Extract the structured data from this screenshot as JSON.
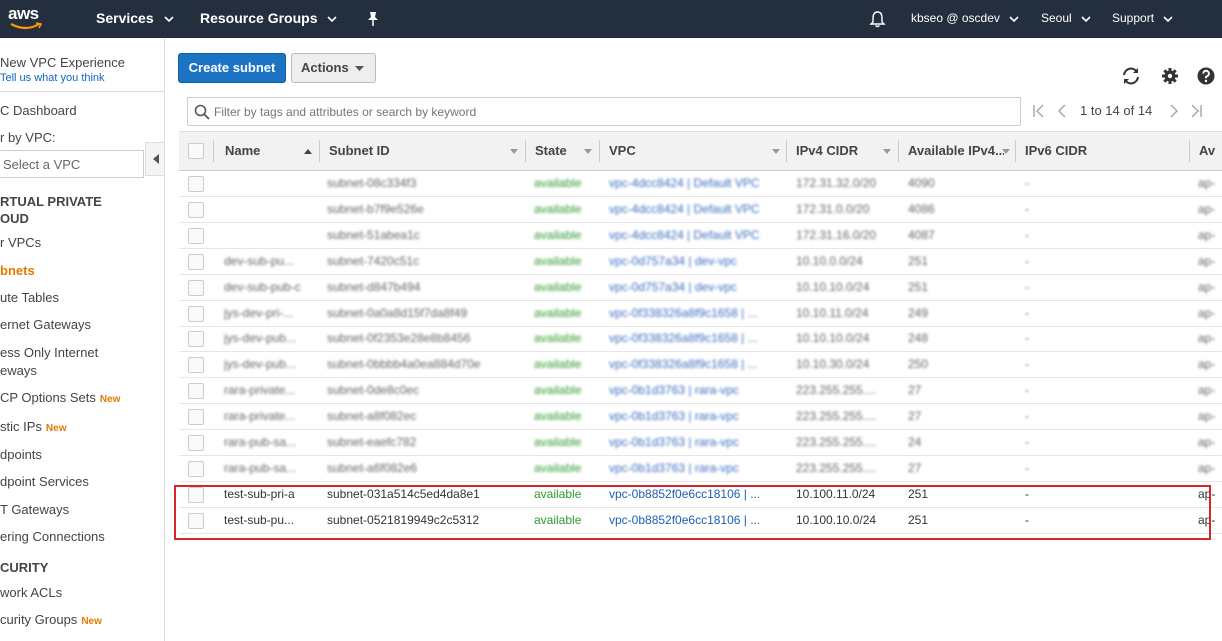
{
  "nav": {
    "logo": "aws",
    "services": "Services",
    "resource_groups": "Resource Groups",
    "user": "kbseo @ oscdev",
    "region": "Seoul",
    "support": "Support"
  },
  "sidebar": {
    "new_experience": "New VPC Experience",
    "tell_us": "Tell us what you think",
    "dashboard": "C Dashboard",
    "filter_label": "r by VPC:",
    "vpc_select": "Select a VPC",
    "section_vpc_1": "RTUAL PRIVATE",
    "section_vpc_2": "OUD",
    "your_vpcs": "r VPCs",
    "subnets": "bnets",
    "route_tables": "ute Tables",
    "internet_gateways": "ernet Gateways",
    "egress_1": "ess Only Internet",
    "egress_2": "eways",
    "dhcp": "CP Options Sets",
    "elastic_ips": "stic IPs",
    "endpoints": "dpoints",
    "endpoint_services": "dpoint Services",
    "nat": "T Gateways",
    "peering": "ering Connections",
    "section_security": "CURITY",
    "network_acls": "work ACLs",
    "security_groups": "curity Groups",
    "new_badge": "New"
  },
  "toolbar": {
    "create_subnet": "Create subnet",
    "actions": "Actions"
  },
  "filter": {
    "placeholder": "Filter by tags and attributes or search by keyword"
  },
  "pager": {
    "range": "1 to 14 of 14"
  },
  "table": {
    "headers": {
      "name": "Name",
      "subnet_id": "Subnet ID",
      "state": "State",
      "vpc": "VPC",
      "ipv4": "IPv4 CIDR",
      "avail": "Available IPv4...",
      "ipv6": "IPv6 CIDR",
      "az": "Av"
    },
    "rows": [
      {
        "name": "",
        "subnet": "subnet-08c334f3",
        "state": "available",
        "vpc": "vpc-4dcc8424 | Default VPC",
        "ipv4": "172.31.32.0/20",
        "avail": "4090",
        "ipv6": "-",
        "az": "ap-"
      },
      {
        "name": "",
        "subnet": "subnet-b7f9e526e",
        "state": "available",
        "vpc": "vpc-4dcc8424 | Default VPC",
        "ipv4": "172.31.0.0/20",
        "avail": "4086",
        "ipv6": "-",
        "az": "ap-"
      },
      {
        "name": "",
        "subnet": "subnet-51abea1c",
        "state": "available",
        "vpc": "vpc-4dcc8424 | Default VPC",
        "ipv4": "172.31.16.0/20",
        "avail": "4087",
        "ipv6": "-",
        "az": "ap-"
      },
      {
        "name": "dev-sub-pu...",
        "subnet": "subnet-7420c51c",
        "state": "available",
        "vpc": "vpc-0d757a34 | dev-vpc",
        "ipv4": "10.10.0.0/24",
        "avail": "251",
        "ipv6": "-",
        "az": "ap-"
      },
      {
        "name": "dev-sub-pub-c",
        "subnet": "subnet-d847b494",
        "state": "available",
        "vpc": "vpc-0d757a34 | dev-vpc",
        "ipv4": "10.10.10.0/24",
        "avail": "251",
        "ipv6": "-",
        "az": "ap-"
      },
      {
        "name": "jys-dev-pri-...",
        "subnet": "subnet-0a0a8d15f7da8f49",
        "state": "available",
        "vpc": "vpc-0f338326a8f9c1658 | ...",
        "ipv4": "10.10.11.0/24",
        "avail": "249",
        "ipv6": "-",
        "az": "ap-"
      },
      {
        "name": "jys-dev-pub...",
        "subnet": "subnet-0f2353e28e8b8456",
        "state": "available",
        "vpc": "vpc-0f338326a8f9c1658 | ...",
        "ipv4": "10.10.10.0/24",
        "avail": "248",
        "ipv6": "-",
        "az": "ap-"
      },
      {
        "name": "jys-dev-pub...",
        "subnet": "subnet-0bbbb4a0ea884d70e",
        "state": "available",
        "vpc": "vpc-0f338326a8f9c1658 | ...",
        "ipv4": "10.10.30.0/24",
        "avail": "250",
        "ipv6": "-",
        "az": "ap-"
      },
      {
        "name": "rara-private...",
        "subnet": "subnet-0de8c0ec",
        "state": "available",
        "vpc": "vpc-0b1d3763 | rara-vpc",
        "ipv4": "223.255.255....",
        "avail": "27",
        "ipv6": "-",
        "az": "ap-"
      },
      {
        "name": "rara-private...",
        "subnet": "subnet-a8f082ec",
        "state": "available",
        "vpc": "vpc-0b1d3763 | rara-vpc",
        "ipv4": "223.255.255....",
        "avail": "27",
        "ipv6": "-",
        "az": "ap-"
      },
      {
        "name": "rara-pub-sa...",
        "subnet": "subnet-eaefc782",
        "state": "available",
        "vpc": "vpc-0b1d3763 | rara-vpc",
        "ipv4": "223.255.255....",
        "avail": "24",
        "ipv6": "-",
        "az": "ap-"
      },
      {
        "name": "rara-pub-sa...",
        "subnet": "subnet-a6f082e6",
        "state": "available",
        "vpc": "vpc-0b1d3763 | rara-vpc",
        "ipv4": "223.255.255....",
        "avail": "27",
        "ipv6": "-",
        "az": "ap-"
      },
      {
        "name": "test-sub-pri-a",
        "subnet": "subnet-031a514c5ed4da8e1",
        "state": "available",
        "vpc": "vpc-0b8852f0e6cc18106 | ...",
        "ipv4": "10.100.11.0/24",
        "avail": "251",
        "ipv6": "-",
        "az": "ap-"
      },
      {
        "name": "test-sub-pu...",
        "subnet": "subnet-0521819949c2c5312",
        "state": "available",
        "vpc": "vpc-0b8852f0e6cc18106 | ...",
        "ipv4": "10.100.10.0/24",
        "avail": "251",
        "ipv6": "-",
        "az": "ap-"
      }
    ]
  },
  "colors": {
    "nav_bg": "#232f3e",
    "primary": "#1c73c4",
    "active": "#e07b00",
    "available": "#2e9b2e",
    "link": "#1e5fb3",
    "highlight": "#d5262e"
  },
  "icons": [
    "bell-icon",
    "pin-icon",
    "refresh-icon",
    "gear-icon",
    "help-icon",
    "search-icon",
    "first-page-icon",
    "prev-page-icon",
    "next-page-icon",
    "last-page-icon",
    "collapse-icon"
  ]
}
